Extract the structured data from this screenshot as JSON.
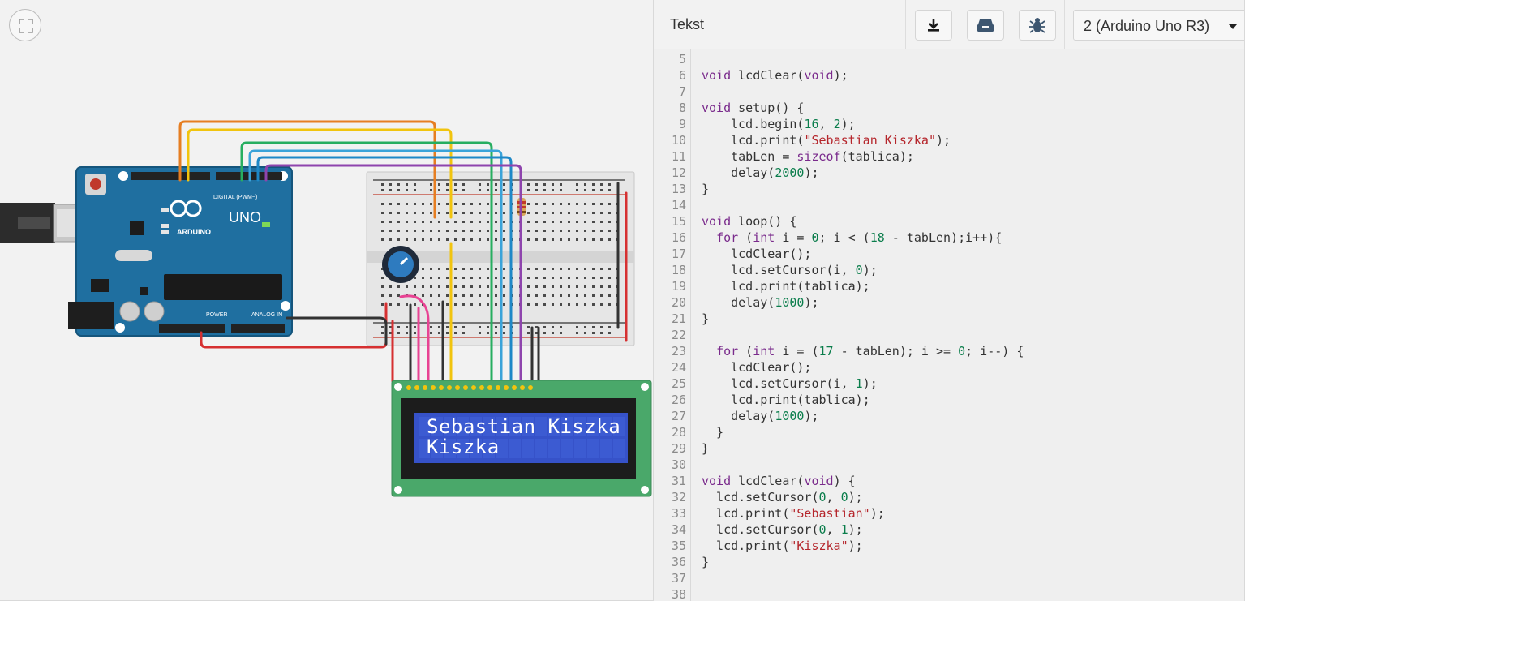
{
  "canvas": {
    "lcd_line1": "Sebastian Kiszka",
    "lcd_line2": "Kiszka",
    "board_model": "UNO",
    "board_brand": "ARDUINO",
    "digital_label": "DIGITAL (PWM~)",
    "power_label": "POWER",
    "analog_label": "ANALOG IN"
  },
  "panel": {
    "title": "Tekst",
    "toolbar": {
      "download_icon": "download-icon",
      "library_icon": "library-icon",
      "debug_icon": "bug-icon"
    },
    "device_select": "2 (Arduino Uno R3)"
  },
  "code": {
    "lines": [
      {
        "n": "5",
        "t": []
      },
      {
        "n": "6",
        "t": [
          {
            "c": "kw",
            "v": "void"
          },
          {
            "c": "pl",
            "v": " lcdClear("
          },
          {
            "c": "kw",
            "v": "void"
          },
          {
            "c": "pl",
            "v": ");"
          }
        ]
      },
      {
        "n": "7",
        "t": []
      },
      {
        "n": "8",
        "t": [
          {
            "c": "kw",
            "v": "void"
          },
          {
            "c": "pl",
            "v": " setup() {"
          }
        ]
      },
      {
        "n": "9",
        "t": [
          {
            "c": "pl",
            "v": "    lcd.begin("
          },
          {
            "c": "num",
            "v": "16"
          },
          {
            "c": "pl",
            "v": ", "
          },
          {
            "c": "num",
            "v": "2"
          },
          {
            "c": "pl",
            "v": ");"
          }
        ]
      },
      {
        "n": "10",
        "t": [
          {
            "c": "pl",
            "v": "    lcd.print("
          },
          {
            "c": "str",
            "v": "\"Sebastian Kiszka\""
          },
          {
            "c": "pl",
            "v": ");"
          }
        ]
      },
      {
        "n": "11",
        "t": [
          {
            "c": "pl",
            "v": "    tabLen = "
          },
          {
            "c": "kw",
            "v": "sizeof"
          },
          {
            "c": "pl",
            "v": "(tablica);"
          }
        ]
      },
      {
        "n": "12",
        "t": [
          {
            "c": "pl",
            "v": "    delay("
          },
          {
            "c": "num",
            "v": "2000"
          },
          {
            "c": "pl",
            "v": ");"
          }
        ]
      },
      {
        "n": "13",
        "t": [
          {
            "c": "pl",
            "v": "}"
          }
        ]
      },
      {
        "n": "14",
        "t": []
      },
      {
        "n": "15",
        "t": [
          {
            "c": "kw",
            "v": "void"
          },
          {
            "c": "pl",
            "v": " loop() {"
          }
        ]
      },
      {
        "n": "16",
        "t": [
          {
            "c": "pl",
            "v": "  "
          },
          {
            "c": "kw",
            "v": "for"
          },
          {
            "c": "pl",
            "v": " ("
          },
          {
            "c": "kw",
            "v": "int"
          },
          {
            "c": "pl",
            "v": " i = "
          },
          {
            "c": "num",
            "v": "0"
          },
          {
            "c": "pl",
            "v": "; i < ("
          },
          {
            "c": "num",
            "v": "18"
          },
          {
            "c": "pl",
            "v": " - tabLen);i++){"
          }
        ]
      },
      {
        "n": "17",
        "t": [
          {
            "c": "pl",
            "v": "    lcdClear();"
          }
        ]
      },
      {
        "n": "18",
        "t": [
          {
            "c": "pl",
            "v": "    lcd.setCursor(i, "
          },
          {
            "c": "num",
            "v": "0"
          },
          {
            "c": "pl",
            "v": ");"
          }
        ]
      },
      {
        "n": "19",
        "t": [
          {
            "c": "pl",
            "v": "    lcd.print(tablica);"
          }
        ]
      },
      {
        "n": "20",
        "t": [
          {
            "c": "pl",
            "v": "    delay("
          },
          {
            "c": "num",
            "v": "1000"
          },
          {
            "c": "pl",
            "v": ");"
          }
        ]
      },
      {
        "n": "21",
        "t": [
          {
            "c": "pl",
            "v": "}"
          }
        ]
      },
      {
        "n": "22",
        "t": []
      },
      {
        "n": "23",
        "t": [
          {
            "c": "pl",
            "v": "  "
          },
          {
            "c": "kw",
            "v": "for"
          },
          {
            "c": "pl",
            "v": " ("
          },
          {
            "c": "kw",
            "v": "int"
          },
          {
            "c": "pl",
            "v": " i = ("
          },
          {
            "c": "num",
            "v": "17"
          },
          {
            "c": "pl",
            "v": " - tabLen); i >= "
          },
          {
            "c": "num",
            "v": "0"
          },
          {
            "c": "pl",
            "v": "; i--) {"
          }
        ]
      },
      {
        "n": "24",
        "t": [
          {
            "c": "pl",
            "v": "    lcdClear();"
          }
        ]
      },
      {
        "n": "25",
        "t": [
          {
            "c": "pl",
            "v": "    lcd.setCursor(i, "
          },
          {
            "c": "num",
            "v": "1"
          },
          {
            "c": "pl",
            "v": ");"
          }
        ]
      },
      {
        "n": "26",
        "t": [
          {
            "c": "pl",
            "v": "    lcd.print(tablica);"
          }
        ]
      },
      {
        "n": "27",
        "t": [
          {
            "c": "pl",
            "v": "    delay("
          },
          {
            "c": "num",
            "v": "1000"
          },
          {
            "c": "pl",
            "v": ");"
          }
        ]
      },
      {
        "n": "28",
        "t": [
          {
            "c": "pl",
            "v": "  }"
          }
        ]
      },
      {
        "n": "29",
        "t": [
          {
            "c": "pl",
            "v": "}"
          }
        ]
      },
      {
        "n": "30",
        "t": []
      },
      {
        "n": "31",
        "t": [
          {
            "c": "kw",
            "v": "void"
          },
          {
            "c": "pl",
            "v": " lcdClear("
          },
          {
            "c": "kw",
            "v": "void"
          },
          {
            "c": "pl",
            "v": ") {"
          }
        ]
      },
      {
        "n": "32",
        "t": [
          {
            "c": "pl",
            "v": "  lcd.setCursor("
          },
          {
            "c": "num",
            "v": "0"
          },
          {
            "c": "pl",
            "v": ", "
          },
          {
            "c": "num",
            "v": "0"
          },
          {
            "c": "pl",
            "v": ");"
          }
        ]
      },
      {
        "n": "33",
        "t": [
          {
            "c": "pl",
            "v": "  lcd.print("
          },
          {
            "c": "str",
            "v": "\"Sebastian\""
          },
          {
            "c": "pl",
            "v": ");"
          }
        ]
      },
      {
        "n": "34",
        "t": [
          {
            "c": "pl",
            "v": "  lcd.setCursor("
          },
          {
            "c": "num",
            "v": "0"
          },
          {
            "c": "pl",
            "v": ", "
          },
          {
            "c": "num",
            "v": "1"
          },
          {
            "c": "pl",
            "v": ");"
          }
        ]
      },
      {
        "n": "35",
        "t": [
          {
            "c": "pl",
            "v": "  lcd.print("
          },
          {
            "c": "str",
            "v": "\"Kiszka\""
          },
          {
            "c": "pl",
            "v": ");"
          }
        ]
      },
      {
        "n": "36",
        "t": [
          {
            "c": "pl",
            "v": "}"
          }
        ]
      },
      {
        "n": "37",
        "t": []
      },
      {
        "n": "38",
        "t": []
      }
    ]
  }
}
